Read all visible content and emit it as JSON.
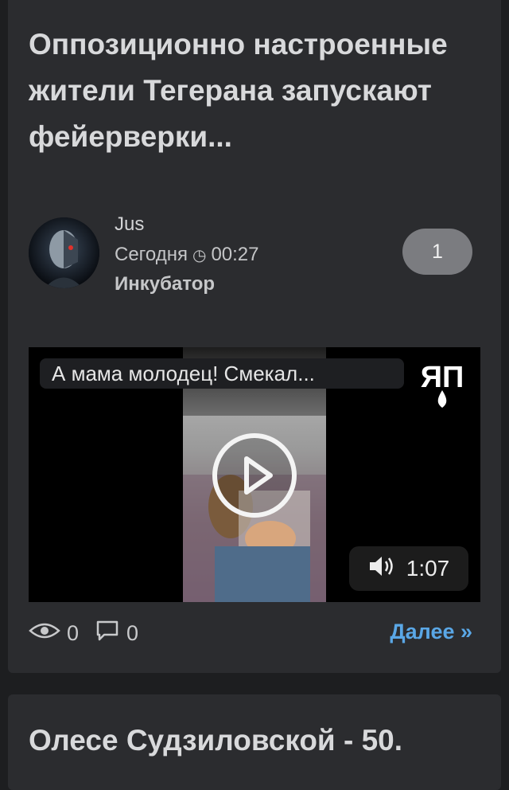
{
  "post1": {
    "title": "Оппозиционно настроенные жители Тегерана запускают фейерверки...",
    "author": "Jus",
    "time_prefix": "Сегодня",
    "time": "00:27",
    "category": "Инкубатор",
    "badge_count": "1",
    "video": {
      "title": "А мама молодец! Смекал...",
      "duration": "1:07",
      "logo_text": "ЯП"
    },
    "views": "0",
    "comments": "0",
    "more_label": "Далее »"
  },
  "post2": {
    "title": "Олесе Судзиловской - 50."
  },
  "colors": {
    "background": "#1d1e20",
    "card": "#2b2c2f",
    "link": "#5aa7e6",
    "badge": "#7b7c80"
  },
  "icons": [
    "clock-icon",
    "play-icon",
    "volume-icon",
    "eye-icon",
    "comment-icon"
  ]
}
